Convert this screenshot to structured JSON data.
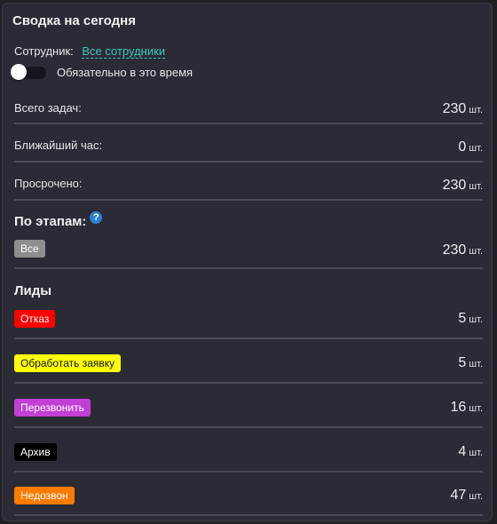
{
  "header": {
    "title": "Сводка на сегодня"
  },
  "filters": {
    "employee_label": "Сотрудник:",
    "employee_value": "Все сотрудники",
    "toggle_label": "Обязательно в это время"
  },
  "unit": "шт.",
  "stats": {
    "total": {
      "label": "Всего задач:",
      "value": "230"
    },
    "next_hour": {
      "label": "Ближайший час:",
      "value": "0"
    },
    "overdue": {
      "label": "Просрочено:",
      "value": "230"
    }
  },
  "stages": {
    "heading": "По этапам:",
    "help_icon": "?",
    "all": {
      "label": "Все",
      "value": "230",
      "color": "#8e8e8e"
    }
  },
  "leads": {
    "heading": "Лиды",
    "items": [
      {
        "label": "Отказ",
        "value": "5",
        "color": "#ff0000",
        "text_color": "#ffffff"
      },
      {
        "label": "Обработать заявку",
        "value": "5",
        "color": "#ffff00",
        "text_color": "#111111"
      },
      {
        "label": "Перезвонить",
        "value": "16",
        "color": "#c23fd6",
        "text_color": "#ffffff"
      },
      {
        "label": "Архив",
        "value": "4",
        "color": "#000000",
        "text_color": "#ffffff"
      },
      {
        "label": "Недозвон",
        "value": "47",
        "color": "#ff7b00",
        "text_color": "#ffffff"
      }
    ]
  }
}
